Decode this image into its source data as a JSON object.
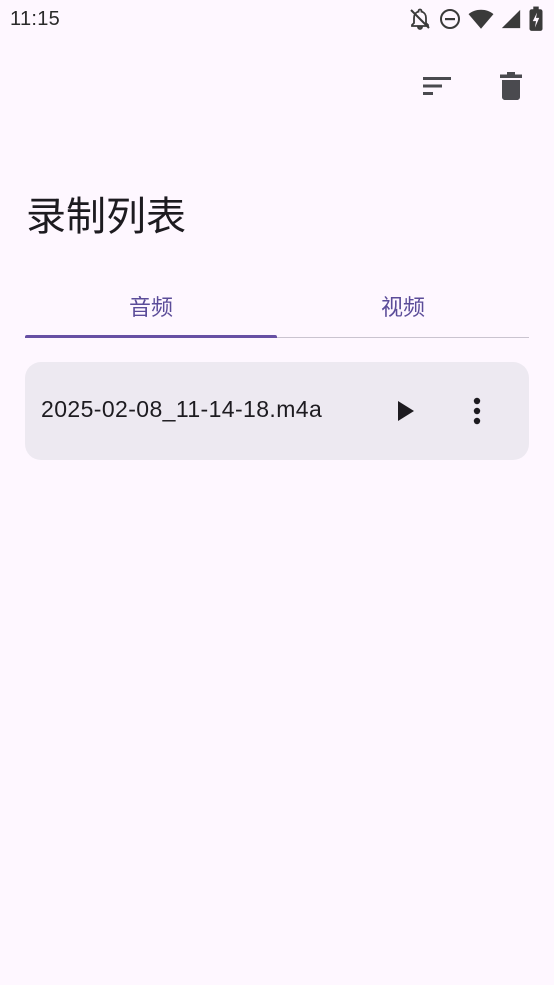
{
  "status_bar": {
    "time": "11:15",
    "icons": [
      "notifications-off-icon",
      "do-not-disturb-icon",
      "wifi-icon",
      "cellular-signal-icon",
      "battery-charging-icon"
    ]
  },
  "toolbar": {
    "actions": [
      "sort-icon",
      "delete-icon"
    ]
  },
  "page": {
    "title": "录制列表"
  },
  "tabs": [
    {
      "label": "音频",
      "selected": true
    },
    {
      "label": "视频",
      "selected": false
    }
  ],
  "recordings": [
    {
      "file_name": "2025-02-08_11-14-18.m4a"
    }
  ],
  "colors": {
    "background": "#FEF7FF",
    "accent": "#6750A4",
    "tab_text": "#5B4C99",
    "card_background": "#EDE9F1",
    "text_primary": "#1D1B20"
  }
}
